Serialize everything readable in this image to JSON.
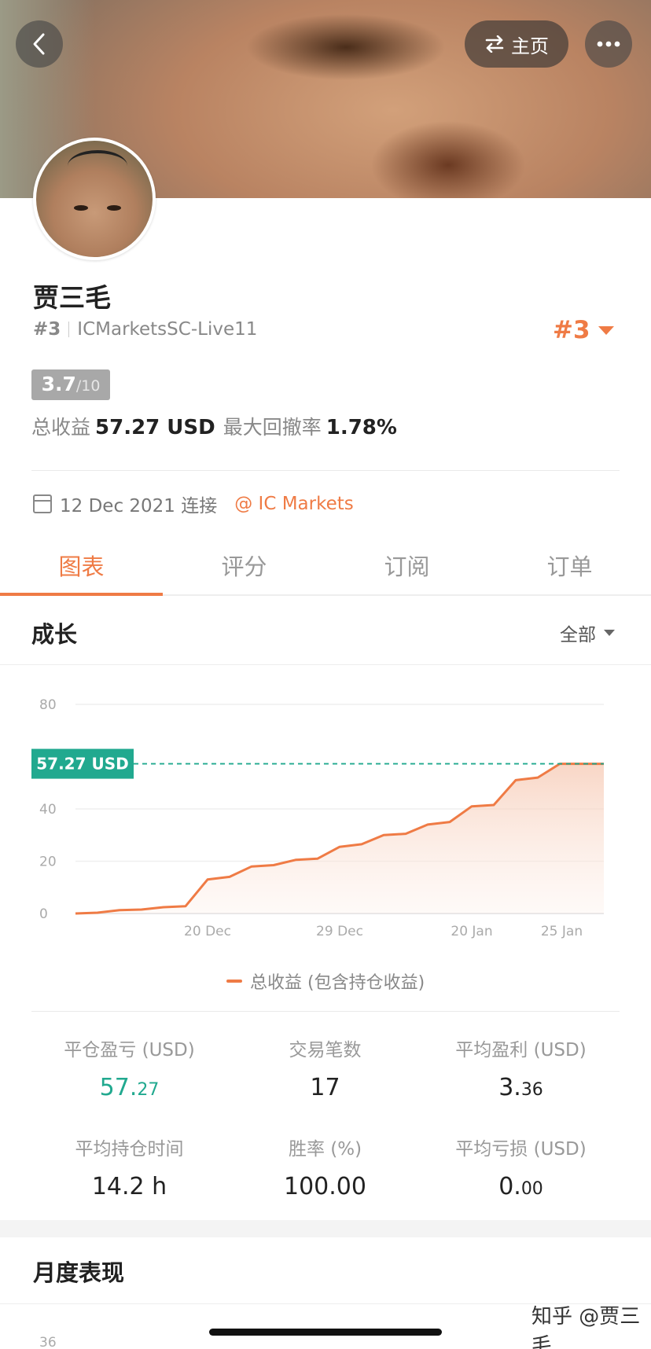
{
  "header": {
    "home_label": "主页"
  },
  "profile": {
    "name": "贾三毛",
    "rank_prefix": "#3",
    "server": "ICMarketsSC-Live11",
    "rank_right": "#3",
    "score": "3.7",
    "score_max": "/10",
    "total_profit_label": "总收益",
    "total_profit_value": "57.27 USD",
    "max_drawdown_label": "最大回撤率",
    "max_drawdown_value": "1.78%",
    "connect_date": "12 Dec 2021 连接",
    "broker": "@ IC Markets"
  },
  "tabs": [
    {
      "label": "图表",
      "active": true
    },
    {
      "label": "评分",
      "active": false
    },
    {
      "label": "订阅",
      "active": false
    },
    {
      "label": "订单",
      "active": false
    }
  ],
  "growth": {
    "title": "成长",
    "filter": "全部"
  },
  "chart_data": {
    "type": "area",
    "title": "",
    "xlabel": "",
    "ylabel": "",
    "ylim": [
      0,
      80
    ],
    "yticks": [
      0,
      20,
      40,
      80
    ],
    "x_ticks": [
      "20 Dec",
      "29 Dec",
      "20 Jan",
      "25 Jan"
    ],
    "current_label": "57.27 USD",
    "current_value": 57.27,
    "series": [
      {
        "name": "总收益 (包含持仓收益)",
        "values": [
          0,
          0.3,
          1.3,
          1.5,
          2.4,
          2.8,
          13,
          14,
          18,
          18.5,
          20.5,
          21,
          25.5,
          26.5,
          30,
          30.5,
          34,
          35,
          41,
          41.5,
          51,
          52,
          57.27,
          57.27,
          57.27
        ],
        "color": "#ef7b45"
      }
    ],
    "tick_positions": [
      0.25,
      0.5,
      0.75,
      0.96
    ],
    "grid": true,
    "legend": "bottom"
  },
  "legend_label": "总收益 (包含持仓收益)",
  "metrics": [
    {
      "label": "平仓盈亏 (USD)",
      "int": "57.",
      "dec": "27",
      "green": true
    },
    {
      "label": "交易笔数",
      "int": "17",
      "dec": "",
      "green": false
    },
    {
      "label": "平均盈利 (USD)",
      "int": "3.",
      "dec": "36",
      "green": false
    },
    {
      "label": "平均持仓时间",
      "int": "14.2 h",
      "dec": "",
      "green": false
    },
    {
      "label": "胜率 (%)",
      "int": "100.00",
      "dec": "",
      "green": false
    },
    {
      "label": "平均亏损 (USD)",
      "int": "0.",
      "dec": "00",
      "green": false
    }
  ],
  "monthly": {
    "title": "月度表现",
    "first_tick": "36"
  },
  "watermark": "知乎 @贾三毛"
}
